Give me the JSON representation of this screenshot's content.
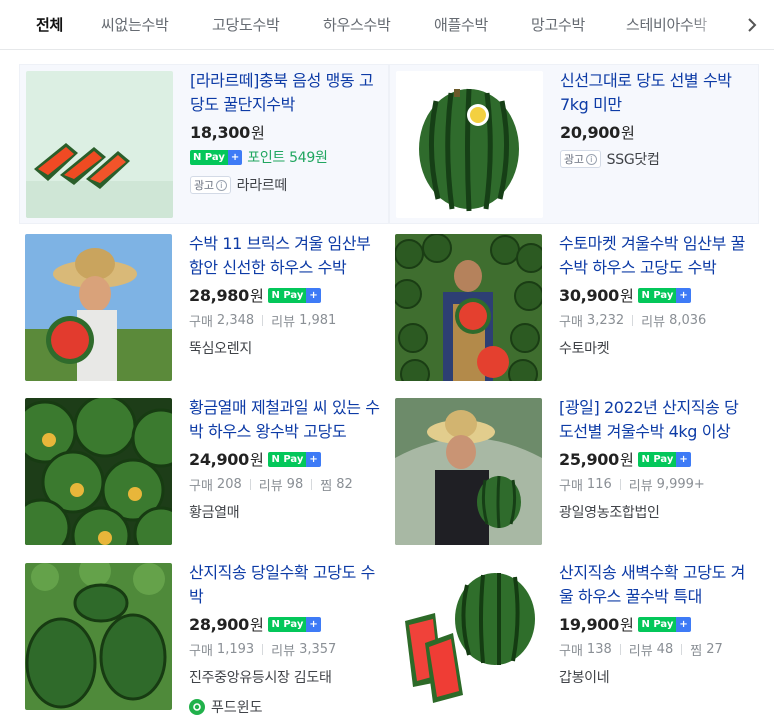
{
  "tabs": [
    {
      "label": "전체",
      "active": true
    },
    {
      "label": "씨없는수박",
      "active": false
    },
    {
      "label": "고당도수박",
      "active": false
    },
    {
      "label": "하우스수박",
      "active": false
    },
    {
      "label": "애플수박",
      "active": false
    },
    {
      "label": "망고수박",
      "active": false
    },
    {
      "label": "스테비아수박",
      "active": false
    }
  ],
  "won": "원",
  "npay": {
    "n": "N Pay",
    "plus": "+"
  },
  "ad_label": "광고",
  "ad_info_glyph": "i",
  "stat_labels": {
    "purchase": "구매",
    "review": "리뷰",
    "wish": "찜"
  },
  "products": [
    {
      "title": "[라라르떼]충북 음성 맹동 고당도 꿀단지수박",
      "price": "18,300",
      "point_label": "포인트 549원",
      "mall": "라라르떼",
      "is_ad": true
    },
    {
      "title": "신선그대로 당도 선별 수박 7kg 미만",
      "price": "20,900",
      "mall": "SSG닷컴",
      "is_ad": true
    },
    {
      "title": "수박 11 브릭스 겨울 임산부 함안 신선한 하우스 수박",
      "price": "28,980",
      "purchase": "2,348",
      "review": "1,981",
      "mall": "뚝심오렌지"
    },
    {
      "title": "수토마켓 겨울수박 임산부 꿀수박 하우스 고당도 수박",
      "price": "30,900",
      "purchase": "3,232",
      "review": "8,036",
      "mall": "수토마켓"
    },
    {
      "title": "황금열매 제철과일 씨 있는 수박 하우스 왕수박 고당도",
      "price": "24,900",
      "purchase": "208",
      "review": "98",
      "wish": "82",
      "mall": "황금열매"
    },
    {
      "title": "[광일] 2022년 산지직송 당도선별 겨울수박 4kg 이상",
      "price": "25,900",
      "purchase": "116",
      "review": "9,999+",
      "mall": "광일영농조합법인"
    },
    {
      "title": "산지직송 당일수확 고당도 수박",
      "price": "28,900",
      "purchase": "1,193",
      "review": "3,357",
      "mall": "진주중앙유등시장 김도태",
      "sub_mall": "푸드윈도"
    },
    {
      "title": "산지직송 새벽수확 고당도 겨울 하우스 꿀수박 특대",
      "price": "19,900",
      "purchase": "138",
      "review": "48",
      "wish": "27",
      "mall": "갑봉이네"
    }
  ],
  "icons": {
    "next": "chevron-right-icon"
  },
  "colors": {
    "title_link": "#0d3ba6",
    "npay_green": "#03c75a",
    "point_green": "#21a660",
    "ad_bg": "#f6f8fd"
  }
}
